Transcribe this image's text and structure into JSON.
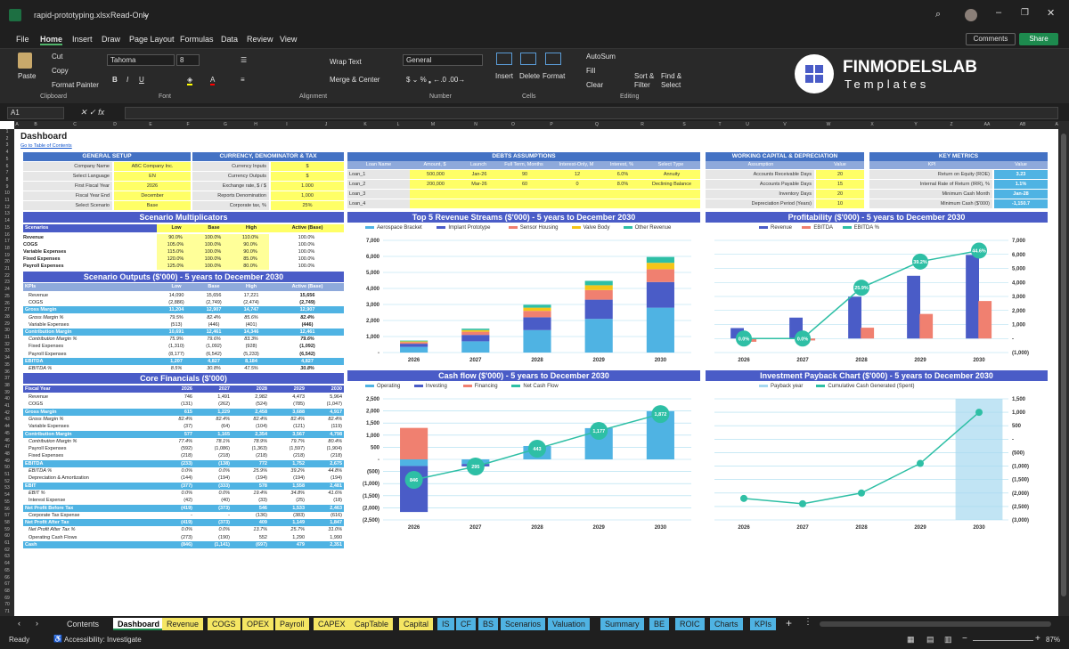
{
  "app": {
    "filename": "rapid-prototyping.xlsx",
    "mode": "Read-Only"
  },
  "menu": [
    "File",
    "Home",
    "Insert",
    "Draw",
    "Page Layout",
    "Formulas",
    "Data",
    "Review",
    "View"
  ],
  "topright": {
    "comments": "Comments",
    "share": "Share"
  },
  "ribbon": {
    "paste": "Paste",
    "cut": "Cut",
    "copy": "Copy",
    "format_painter": "Format Painter",
    "clipboard": "Clipboard",
    "font_name": "Tahoma",
    "font_size": "8",
    "font": "Font",
    "wrap": "Wrap Text",
    "merge": "Merge & Center",
    "alignment": "Alignment",
    "number_format": "General",
    "number": "Number",
    "insert": "Insert",
    "delete": "Delete",
    "format": "Format",
    "cells": "Cells",
    "autosum": "AutoSum",
    "fill": "Fill",
    "clear": "Clear",
    "sort": "Sort & Filter",
    "find": "Find & Select",
    "editing": "Editing"
  },
  "logo": {
    "line1": "FINMODELSLAB",
    "line2": "Templates"
  },
  "namebox": "A1",
  "columns": [
    "A",
    "B",
    "C",
    "D",
    "E",
    "F",
    "G",
    "H",
    "I",
    "J",
    "K",
    "L",
    "M",
    "N",
    "O",
    "P",
    "Q",
    "R",
    "S",
    "T",
    "U",
    "V",
    "W",
    "X",
    "Y",
    "Z",
    "AA",
    "AB",
    "AC",
    "AD"
  ],
  "sheet": {
    "title": "Dashboard",
    "toc": "Go to Table of Contents",
    "general": {
      "header": "GENERAL SETUP",
      "rows": [
        [
          "Company Name",
          "ABC Company Inc."
        ],
        [
          "Select Language",
          "EN"
        ],
        [
          "First Fiscal Year",
          "2026"
        ],
        [
          "Fiscal Year End",
          "December"
        ],
        [
          "Select Scenario",
          "Base"
        ]
      ]
    },
    "currency": {
      "header": "CURRENCY, DENOMINATOR & TAX",
      "rows": [
        [
          "Currency Inputs",
          "$"
        ],
        [
          "Currency Outputs",
          "$"
        ],
        [
          "Exchange rate, $ / $",
          "1.000"
        ],
        [
          "Reports Denomination",
          "1,000"
        ],
        [
          "Corporate tax, %",
          "25%"
        ]
      ]
    },
    "debts": {
      "header": "DEBTS ASSUMPTIONS",
      "cols": [
        "Loan Name",
        "Amount, $",
        "Launch",
        "Full Term, Months",
        "Interest-Only, M",
        "Interest, %",
        "Select Type"
      ],
      "rows": [
        [
          "Loan_1",
          "500,000",
          "Jan-26",
          "90",
          "12",
          "6.0%",
          "Annuity"
        ],
        [
          "Loan_2",
          "200,000",
          "Mar-26",
          "60",
          "0",
          "8.0%",
          "Declining Balance"
        ],
        [
          "Loan_3",
          "",
          "",
          "",
          "",
          "",
          ""
        ],
        [
          "Loan_4",
          "",
          "",
          "",
          "",
          "",
          ""
        ]
      ]
    },
    "wc": {
      "header": "WORKING CAPITAL & DEPRECIATION",
      "cols": [
        "Assumption",
        "Value"
      ],
      "rows": [
        [
          "Accounts Receivable Days",
          "20"
        ],
        [
          "Accounts Payable Days",
          "15"
        ],
        [
          "Inventory Days",
          "20"
        ],
        [
          "Depreciation Period (Years)",
          "10"
        ]
      ]
    },
    "kpi": {
      "header": "KEY METRICS",
      "cols": [
        "KPI",
        "Value"
      ],
      "rows": [
        [
          "Return on Equity (ROE)",
          "3.23"
        ],
        [
          "Internal Rate of Return (IRR), %",
          "1.1%"
        ],
        [
          "Minimum Cash Month",
          "Jan-28"
        ],
        [
          "Minimum Cash ($'000)",
          "-1,150.7"
        ]
      ]
    },
    "scen_mult": {
      "header": "Scenario Multiplicators",
      "cols": [
        "Scenarios",
        "Low",
        "Base",
        "High",
        "Active (Base)"
      ],
      "rows": [
        [
          "Revenue",
          "90.0%",
          "100.0%",
          "110.0%",
          "100.0%"
        ],
        [
          "COGS",
          "105.0%",
          "100.0%",
          "90.0%",
          "100.0%"
        ],
        [
          "Variable Expenses",
          "115.0%",
          "100.0%",
          "90.0%",
          "100.0%"
        ],
        [
          "Fixed Expenses",
          "120.0%",
          "100.0%",
          "85.0%",
          "100.0%"
        ],
        [
          "Payroll Expenses",
          "125.0%",
          "100.0%",
          "80.0%",
          "100.0%"
        ]
      ]
    },
    "scen_out": {
      "header": "Scenario Outputs ($'000) - 5 years to December 2030",
      "cols": [
        "KPIs",
        "Low",
        "Base",
        "High",
        "Active (Base)"
      ],
      "rows": [
        [
          "Revenue",
          "14,090",
          "15,656",
          "17,221",
          "15,656",
          0
        ],
        [
          "COGS",
          "(2,886)",
          "(2,749)",
          "(2,474)",
          "(2,749)",
          0
        ],
        [
          "Gross Margin",
          "11,204",
          "12,907",
          "14,747",
          "12,907",
          1
        ],
        [
          "Gross Margin %",
          "79.5%",
          "82.4%",
          "85.6%",
          "82.4%",
          2
        ],
        [
          "Variable Expenses",
          "(513)",
          "(446)",
          "(401)",
          "(446)",
          0
        ],
        [
          "Contribution Margin",
          "10,691",
          "12,461",
          "14,346",
          "12,461",
          1
        ],
        [
          "Contribution Margin %",
          "75.9%",
          "79.6%",
          "83.3%",
          "79.6%",
          2
        ],
        [
          "Fixed Expenses",
          "(1,310)",
          "(1,092)",
          "(928)",
          "(1,092)",
          0
        ],
        [
          "Payroll Expenses",
          "(8,177)",
          "(6,542)",
          "(5,233)",
          "(6,542)",
          0
        ],
        [
          "EBITDA",
          "1,207",
          "4,827",
          "8,184",
          "4,827",
          1
        ],
        [
          "EBITDA %",
          "8.5%",
          "30.8%",
          "47.5%",
          "30.8%",
          2
        ]
      ]
    },
    "core": {
      "header": "Core Financials ($'000)",
      "cols": [
        "Fiscal Year",
        "2026",
        "2027",
        "2028",
        "2029",
        "2030"
      ],
      "rows": [
        [
          "Revenue",
          "746",
          "1,491",
          "2,982",
          "4,473",
          "5,964",
          0
        ],
        [
          "COGS",
          "(131)",
          "(262)",
          "(524)",
          "(785)",
          "(1,047)",
          0
        ],
        [
          "Gross Margin",
          "615",
          "1,229",
          "2,458",
          "3,688",
          "4,917",
          1
        ],
        [
          "Gross Margin %",
          "82.4%",
          "82.4%",
          "82.4%",
          "82.4%",
          "82.4%",
          2
        ],
        [
          "Variable Expenses",
          "(37)",
          "(64)",
          "(104)",
          "(121)",
          "(119)",
          0
        ],
        [
          "Contribution Margin",
          "577",
          "1,165",
          "2,354",
          "3,567",
          "4,798",
          1
        ],
        [
          "Contribution Margin %",
          "77.4%",
          "78.1%",
          "78.9%",
          "79.7%",
          "80.4%",
          2
        ],
        [
          "Payroll Expenses",
          "(592)",
          "(1,086)",
          "(1,363)",
          "(1,597)",
          "(1,904)",
          0
        ],
        [
          "Fixed Expenses",
          "(218)",
          "(218)",
          "(218)",
          "(218)",
          "(218)",
          0
        ],
        [
          "EBITDA",
          "(233)",
          "(138)",
          "772",
          "1,752",
          "2,675",
          1
        ],
        [
          "EBITDA %",
          "0.0%",
          "0.0%",
          "25.9%",
          "39.2%",
          "44.8%",
          2
        ],
        [
          "Depreciation & Amortization",
          "(144)",
          "(194)",
          "(194)",
          "(194)",
          "(194)",
          0
        ],
        [
          "EBIT",
          "(377)",
          "(333)",
          "578",
          "1,558",
          "2,481",
          1
        ],
        [
          "EBIT %",
          "0.0%",
          "0.0%",
          "19.4%",
          "34.8%",
          "41.6%",
          2
        ],
        [
          "Interest Expense",
          "(42)",
          "(40)",
          "(33)",
          "(25)",
          "(18)",
          0
        ],
        [
          "Net Profit Before Tax",
          "(419)",
          "(373)",
          "546",
          "1,533",
          "2,463",
          1
        ],
        [
          "Corporate Tax Expense",
          "-",
          "-",
          "(136)",
          "(383)",
          "(616)",
          0
        ],
        [
          "Net Profit After Tax",
          "(419)",
          "(373)",
          "409",
          "1,149",
          "1,847",
          1
        ],
        [
          "Net Profit After Tax %",
          "0.0%",
          "0.0%",
          "13.7%",
          "25.7%",
          "31.0%",
          2
        ],
        [
          "Operating Cash Flows",
          "(273)",
          "(190)",
          "552",
          "1,290",
          "1,990",
          0
        ],
        [
          "Cash",
          "(846)",
          "(1,141)",
          "(697)",
          "479",
          "2,351",
          1
        ]
      ]
    }
  },
  "chart_data": [
    {
      "type": "bar",
      "title": "Top 5 Revenue Streams ($'000) - 5 years to December 2030",
      "categories": [
        "2026",
        "2027",
        "2028",
        "2029",
        "2030"
      ],
      "ylim": [
        0,
        7000
      ],
      "yticks": [
        "7,000",
        "6,000",
        "5,000",
        "4,000",
        "3,000",
        "2,000",
        "1,000",
        "-"
      ],
      "series": [
        {
          "name": "Aerospace Bracket",
          "color": "#4fb3e3",
          "values": [
            350,
            700,
            1400,
            2100,
            2800
          ]
        },
        {
          "name": "Implant Prototype",
          "color": "#4a5cc7",
          "values": [
            200,
            400,
            800,
            1200,
            1600
          ]
        },
        {
          "name": "Sensor Housing",
          "color": "#f08070",
          "values": [
            100,
            200,
            400,
            600,
            800
          ]
        },
        {
          "name": "Valve Body",
          "color": "#f5c518",
          "values": [
            50,
            100,
            200,
            300,
            400
          ]
        },
        {
          "name": "Other Revenue",
          "color": "#2ebfa5",
          "values": [
            46,
            91,
            182,
            273,
            364
          ]
        }
      ]
    },
    {
      "type": "bar",
      "title": "Profitability ($'000) - 5 years to December 2030",
      "categories": [
        "2026",
        "2027",
        "2028",
        "2029",
        "2030"
      ],
      "ylim": [
        -1000,
        7000
      ],
      "yticks": [
        "7,000",
        "6,000",
        "5,000",
        "4,000",
        "3,000",
        "2,000",
        "1,000",
        "-",
        "(1,000)"
      ],
      "series": [
        {
          "name": "Revenue",
          "color": "#4a5cc7",
          "values": [
            746,
            1491,
            2982,
            4473,
            5964
          ]
        },
        {
          "name": "EBITDA",
          "color": "#f08070",
          "values": [
            -233,
            -138,
            772,
            1752,
            2675
          ]
        },
        {
          "name": "EBITDA %",
          "color": "#2ebfa5",
          "values": [
            0,
            0,
            25.9,
            39.2,
            44.8
          ],
          "labels": [
            "0.0%",
            "0.0%",
            "25.9%",
            "39.2%",
            "44.6%"
          ]
        }
      ]
    },
    {
      "type": "bar",
      "title": "Cash flow ($'000) - 5 years to December 2030",
      "categories": [
        "2026",
        "2027",
        "2028",
        "2029",
        "2030"
      ],
      "ylim": [
        -2500,
        2500
      ],
      "yticks": [
        "2,500",
        "2,000",
        "1,500",
        "1,000",
        "500",
        "-",
        "(500)",
        "(1,000)",
        "(1,500)",
        "(2,000)",
        "(2,500)"
      ],
      "series": [
        {
          "name": "Operating",
          "color": "#4fb3e3",
          "values": [
            -273,
            -190,
            552,
            1290,
            1990
          ]
        },
        {
          "name": "Investing",
          "color": "#4a5cc7",
          "values": [
            -1900,
            -100,
            0,
            0,
            0
          ]
        },
        {
          "name": "Financing",
          "color": "#f08070",
          "values": [
            1300,
            0,
            0,
            0,
            0
          ]
        },
        {
          "name": "Net Cash Flow",
          "color": "#2ebfa5",
          "values": [
            -846,
            -295,
            443,
            1177,
            1872
          ],
          "labels": [
            "846",
            "295",
            "443",
            "1,177",
            "1,872"
          ]
        }
      ]
    },
    {
      "type": "line",
      "title": "Investment Payback Chart ($'000) - 5 years to December 2030",
      "categories": [
        "2026",
        "2027",
        "2028",
        "2029",
        "2030"
      ],
      "ylim": [
        -3000,
        1500
      ],
      "yticks": [
        "1,500",
        "1,000",
        "500",
        "-",
        "(500)",
        "(1,000)",
        "(1,500)",
        "(2,000)",
        "(2,500)",
        "(3,000)"
      ],
      "series": [
        {
          "name": "Payback year",
          "color": "#a6d8f0",
          "values": [
            0,
            0,
            0,
            0,
            1
          ]
        },
        {
          "name": "Cumulative Cash Generated (Spent)",
          "color": "#2ebfa5",
          "values": [
            -2200,
            -2400,
            -2000,
            -900,
            1000
          ]
        }
      ]
    }
  ],
  "sheettabs": [
    {
      "n": "Contents",
      "c": "#1f1f1f",
      "t": "#ddd"
    },
    {
      "n": "Dashboard",
      "c": "#ffffff",
      "t": "#000"
    },
    {
      "n": "Revenue",
      "c": "#f5e663",
      "t": "#222"
    },
    {
      "n": "COGS",
      "c": "#f5e663",
      "t": "#222"
    },
    {
      "n": "OPEX",
      "c": "#f5e663",
      "t": "#222"
    },
    {
      "n": "Payroll",
      "c": "#f5e663",
      "t": "#222"
    },
    {
      "n": "CAPEX",
      "c": "#f5e663",
      "t": "#222"
    },
    {
      "n": "CapTable",
      "c": "#f5e663",
      "t": "#222"
    },
    {
      "n": "Capital",
      "c": "#f5e663",
      "t": "#222"
    },
    {
      "n": "IS",
      "c": "#4fb3e3",
      "t": "#222"
    },
    {
      "n": "CF",
      "c": "#4fb3e3",
      "t": "#222"
    },
    {
      "n": "BS",
      "c": "#4fb3e3",
      "t": "#222"
    },
    {
      "n": "Scenarios",
      "c": "#4fb3e3",
      "t": "#222"
    },
    {
      "n": "Valuation",
      "c": "#4fb3e3",
      "t": "#222"
    },
    {
      "n": "Summary",
      "c": "#4fb3e3",
      "t": "#222"
    },
    {
      "n": "BE",
      "c": "#4fb3e3",
      "t": "#222"
    },
    {
      "n": "ROIC",
      "c": "#4fb3e3",
      "t": "#222"
    },
    {
      "n": "Charts",
      "c": "#4fb3e3",
      "t": "#222"
    },
    {
      "n": "KPIs",
      "c": "#4fb3e3",
      "t": "#222"
    }
  ],
  "status": {
    "ready": "Ready",
    "accessibility": "Accessibility: Investigate",
    "zoom": "87%"
  }
}
